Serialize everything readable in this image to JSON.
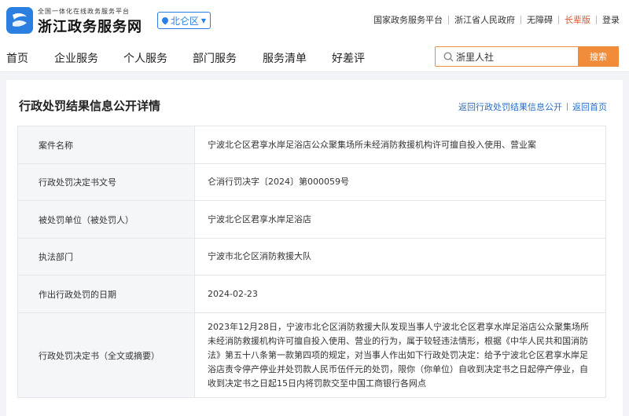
{
  "header": {
    "site_subtitle": "全国一体化在线政务服务平台",
    "site_name": "浙江政务服务网",
    "region": "北仑区",
    "links": [
      "国家政务服务平台",
      "浙江省人民政府",
      "无障碍",
      "长辈版",
      "登录"
    ]
  },
  "nav": {
    "items": [
      "首页",
      "企业服务",
      "个人服务",
      "部门服务",
      "服务清单",
      "好差评"
    ],
    "search_value": "浙里人社",
    "search_button": "搜索"
  },
  "page": {
    "title": "行政处罚结果信息公开详情",
    "back_link": "返回行政处罚结果信息公开",
    "home_link": "返回首页"
  },
  "rows": [
    {
      "label": "案件名称",
      "value": "宁波北仑区君享水岸足浴店公众聚集场所未经消防救援机构许可擅自投入使用、营业案"
    },
    {
      "label": "行政处罚决定书文号",
      "value": "仑消行罚决字〔2024〕第000059号"
    },
    {
      "label": "被处罚单位（被处罚人）",
      "value": "宁波北仑区君享水岸足浴店"
    },
    {
      "label": "执法部门",
      "value": "宁波市北仑区消防救援大队"
    },
    {
      "label": "作出行政处罚的日期",
      "value": "2024-02-23"
    },
    {
      "label": "行政处罚决定书（全文或摘要）",
      "value": "2023年12月28日，宁波市北仑区消防救援大队发现当事人宁波北仑区君享水岸足浴店公众聚集场所未经消防救援机构许可擅自投入使用、营业的行为，属于较轻违法情形，根据《中华人民共和国消防法》第五十八条第一款第四项的规定，对当事人作出如下行政处罚决定：给予宁波北仑区君享水岸足浴店责令停产停业并处罚款人民币伍仟元的处罚，限你（你单位）自收到决定书之日起停产停业，自收到决定书之日起15日内将罚款交至中国工商银行各网点"
    }
  ],
  "colors": {
    "brand_blue": "#2a7fe0",
    "accent_orange": "#f08c3a",
    "link_blue": "#2a6fc9",
    "elder_red": "#e6502a"
  }
}
